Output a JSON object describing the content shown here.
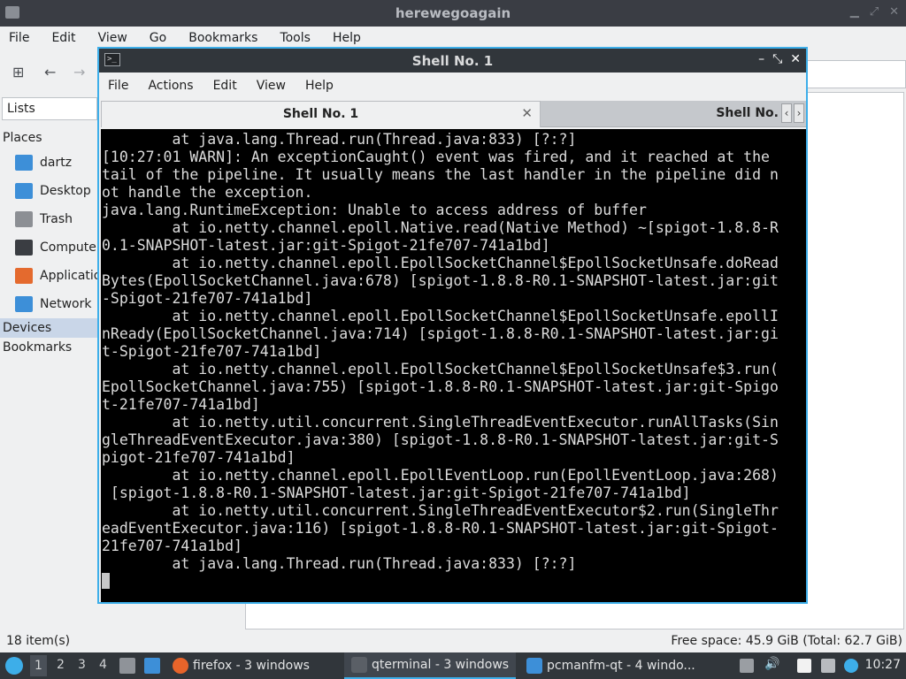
{
  "fm": {
    "title": "herewegoagain",
    "menu": [
      "File",
      "Edit",
      "View",
      "Go",
      "Bookmarks",
      "Tools",
      "Help"
    ],
    "lists_label": "Lists",
    "places_label": "Places",
    "places": [
      {
        "label": "dartz",
        "icon": "home-folder-icon",
        "color": "#3d8fd8"
      },
      {
        "label": "Desktop",
        "icon": "desktop-folder-icon",
        "color": "#3d8fd8"
      },
      {
        "label": "Trash",
        "icon": "trash-icon",
        "color": "#8c8f94"
      },
      {
        "label": "Computer",
        "icon": "computer-icon",
        "color": "#3a3d42"
      },
      {
        "label": "Applications",
        "icon": "applications-icon",
        "color": "#e46a2e"
      },
      {
        "label": "Network",
        "icon": "network-folder-icon",
        "color": "#3d8fd8"
      }
    ],
    "devices_label": "Devices",
    "bookmarks_label": "Bookmarks",
    "status_left": "18 item(s)",
    "status_right": "Free space: 45.9 GiB (Total: 62.7 GiB)"
  },
  "terminal": {
    "title": "Shell No. 1",
    "menu": [
      "File",
      "Actions",
      "Edit",
      "View",
      "Help"
    ],
    "tabs": [
      "Shell No. 1",
      "Shell No."
    ],
    "lines": [
      "        at java.lang.Thread.run(Thread.java:833) [?:?]",
      "[10:27:01 WARN]: An exceptionCaught() event was fired, and it reached at the",
      "tail of the pipeline. It usually means the last handler in the pipeline did n",
      "ot handle the exception.",
      "java.lang.RuntimeException: Unable to access address of buffer",
      "        at io.netty.channel.epoll.Native.read(Native Method) ~[spigot-1.8.8-R",
      "0.1-SNAPSHOT-latest.jar:git-Spigot-21fe707-741a1bd]",
      "        at io.netty.channel.epoll.EpollSocketChannel$EpollSocketUnsafe.doRead",
      "Bytes(EpollSocketChannel.java:678) [spigot-1.8.8-R0.1-SNAPSHOT-latest.jar:git",
      "-Spigot-21fe707-741a1bd]",
      "        at io.netty.channel.epoll.EpollSocketChannel$EpollSocketUnsafe.epollI",
      "nReady(EpollSocketChannel.java:714) [spigot-1.8.8-R0.1-SNAPSHOT-latest.jar:gi",
      "t-Spigot-21fe707-741a1bd]",
      "        at io.netty.channel.epoll.EpollSocketChannel$EpollSocketUnsafe$3.run(",
      "EpollSocketChannel.java:755) [spigot-1.8.8-R0.1-SNAPSHOT-latest.jar:git-Spigo",
      "t-21fe707-741a1bd]",
      "        at io.netty.util.concurrent.SingleThreadEventExecutor.runAllTasks(Sin",
      "gleThreadEventExecutor.java:380) [spigot-1.8.8-R0.1-SNAPSHOT-latest.jar:git-S",
      "pigot-21fe707-741a1bd]",
      "        at io.netty.channel.epoll.EpollEventLoop.run(EpollEventLoop.java:268)",
      " [spigot-1.8.8-R0.1-SNAPSHOT-latest.jar:git-Spigot-21fe707-741a1bd]",
      "        at io.netty.util.concurrent.SingleThreadEventExecutor$2.run(SingleThr",
      "eadEventExecutor.java:116) [spigot-1.8.8-R0.1-SNAPSHOT-latest.jar:git-Spigot-",
      "21fe707-741a1bd]",
      "        at java.lang.Thread.run(Thread.java:833) [?:?]"
    ]
  },
  "taskbar": {
    "workspaces": [
      "1",
      "2",
      "3",
      "4"
    ],
    "tasks": [
      {
        "label": "firefox - 3 windows",
        "icon": "firefox-icon",
        "color": "#e8642a"
      },
      {
        "label": "qterminal - 3 windows",
        "icon": "terminal-icon",
        "color": "#5a5f66"
      },
      {
        "label": "pcmanfm-qt - 4 windo...",
        "icon": "folder-icon",
        "color": "#3d8fd8"
      }
    ],
    "clock": "10:27",
    "accent": "#3daee9"
  }
}
